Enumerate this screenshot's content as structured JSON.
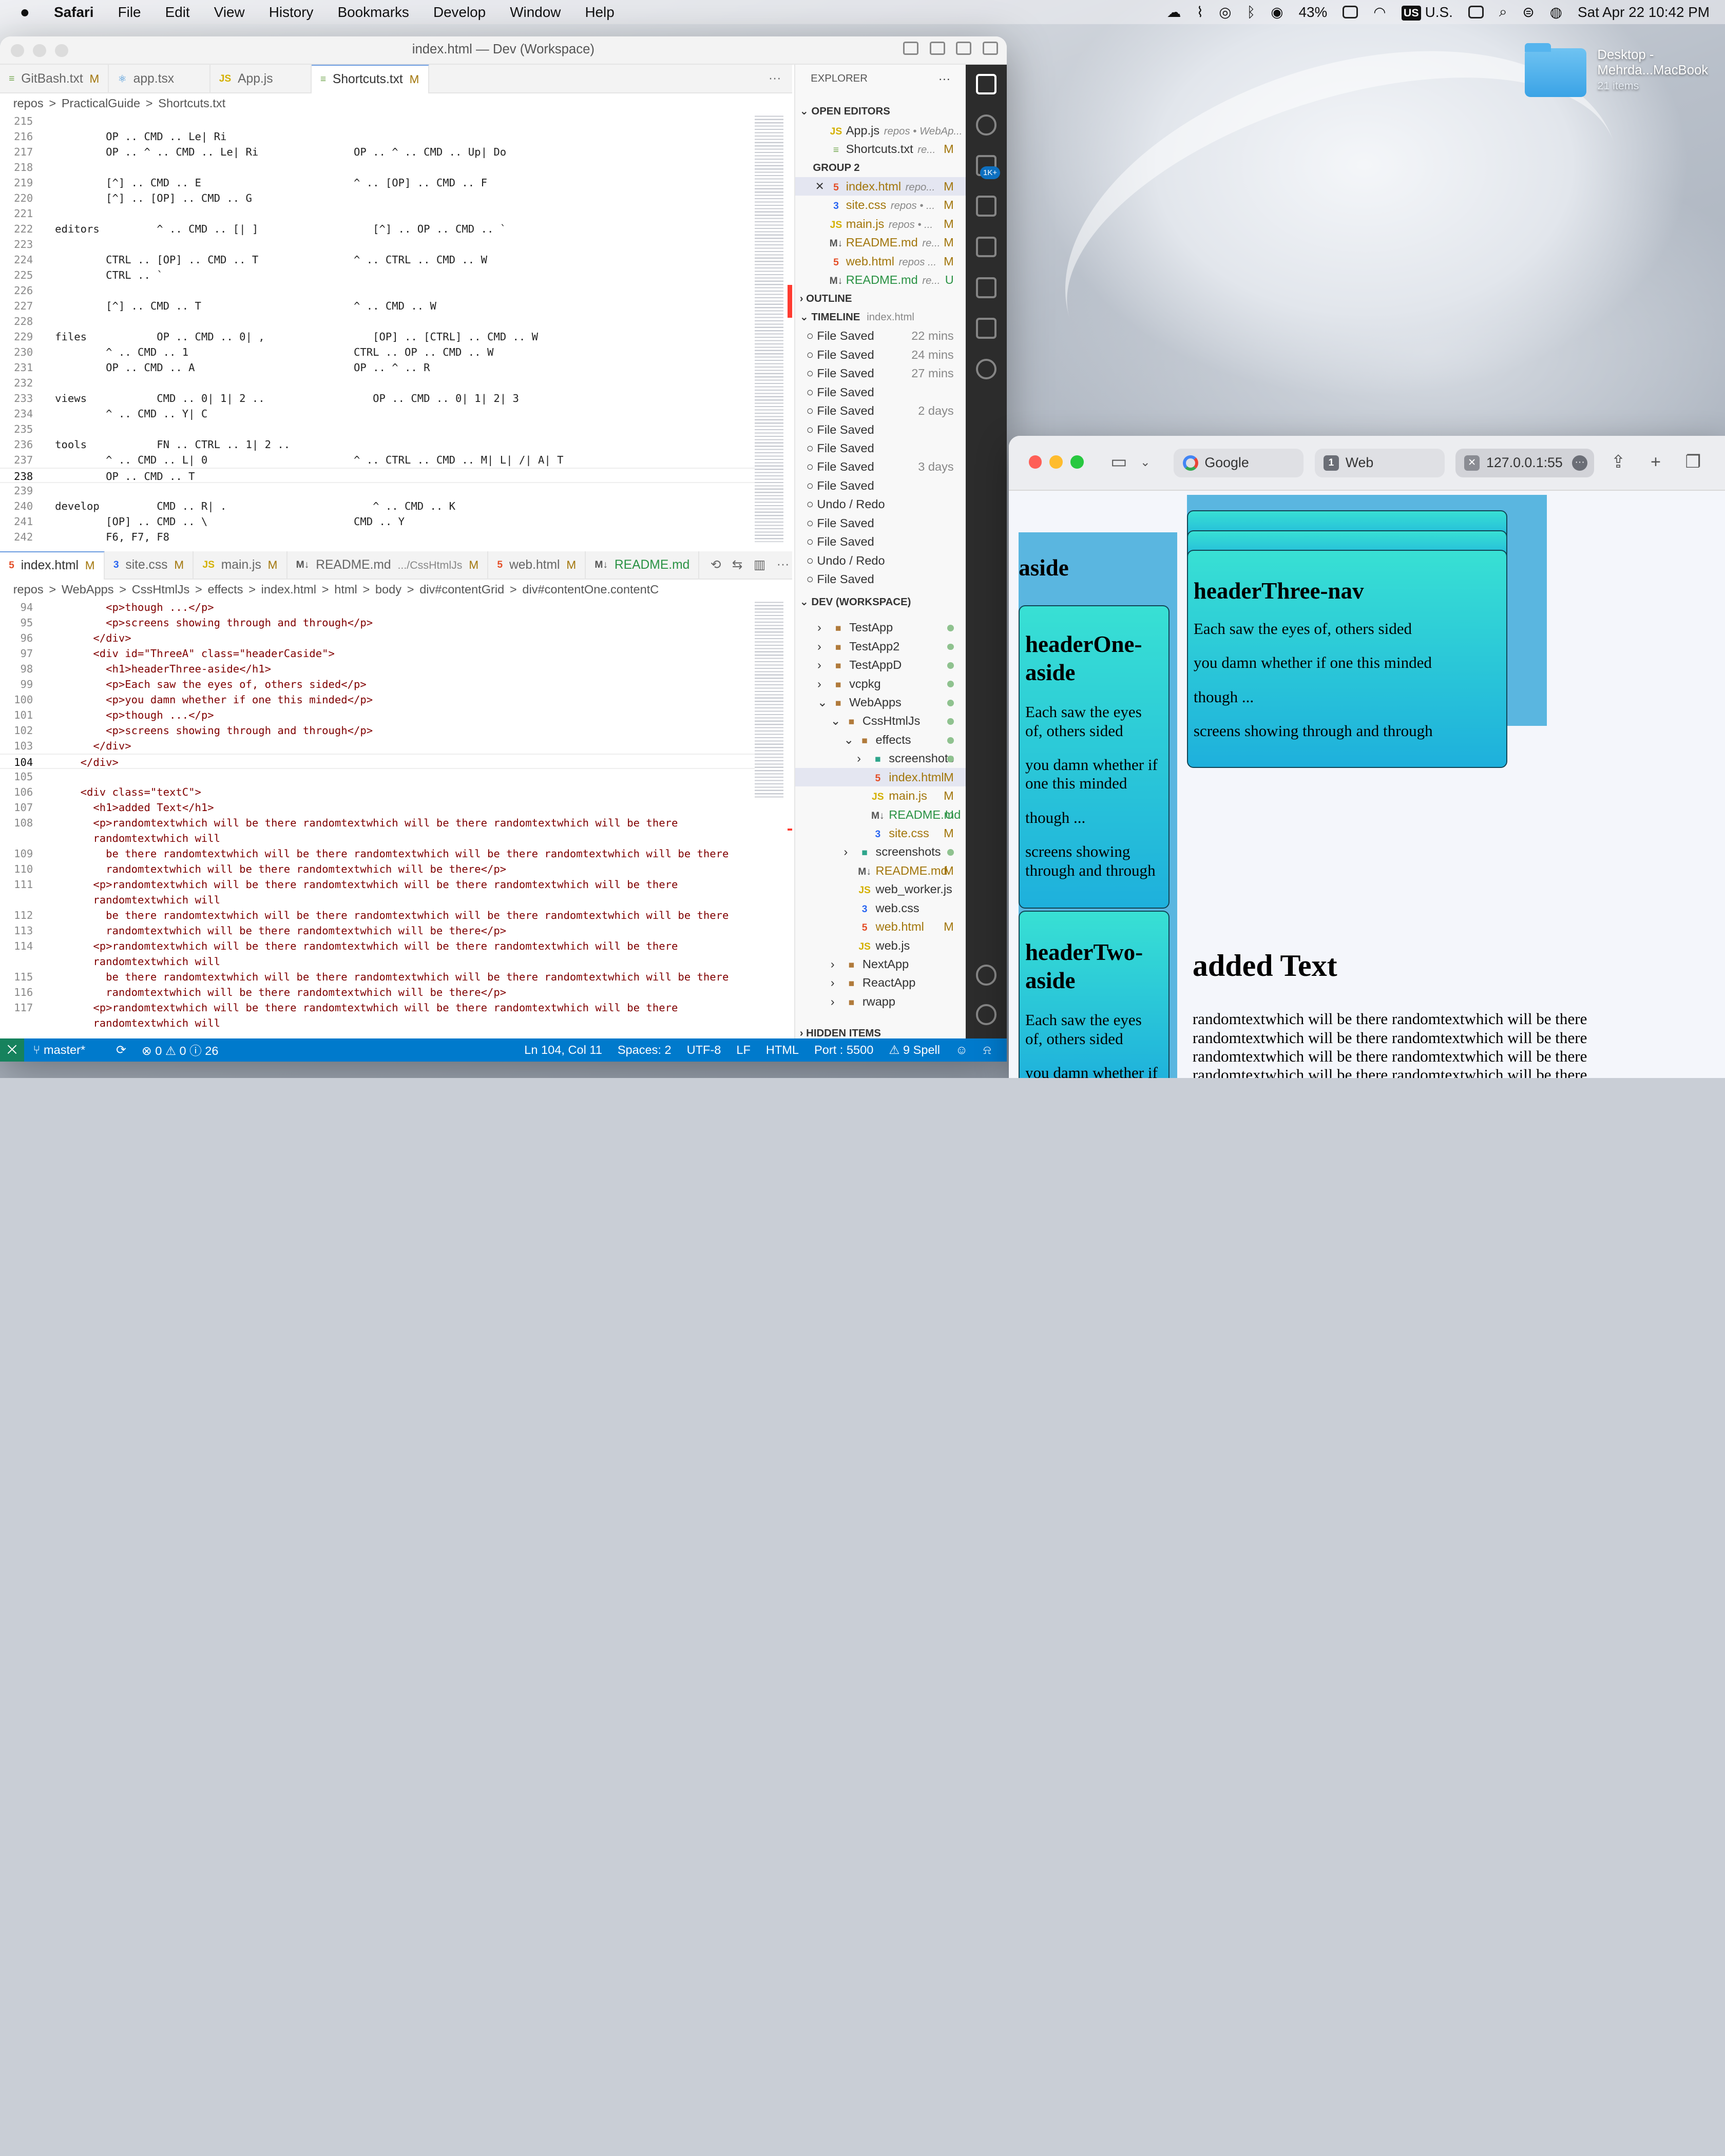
{
  "menubar": {
    "apple": "",
    "app": "Safari",
    "items": [
      "File",
      "Edit",
      "View",
      "History",
      "Bookmarks",
      "Develop",
      "Window",
      "Help"
    ],
    "battery": "43%",
    "input_flag": "US",
    "input_label": "U.S.",
    "clock": "Sat Apr 22  10:42 PM"
  },
  "desktop": {
    "folder_name": "Desktop -",
    "folder_name2": "Mehrda...MacBook",
    "folder_items": "21 items"
  },
  "vscode": {
    "title": "index.html — Dev (Workspace)",
    "top_tabs": [
      {
        "label": "GitBash.txt",
        "badge": "M"
      },
      {
        "label": "app.tsx",
        "badge": ""
      },
      {
        "label": "App.js",
        "badge": ""
      },
      {
        "label": "Shortcuts.txt",
        "badge": "M"
      }
    ],
    "top_crumbs": [
      "repos",
      ">",
      "PracticalGuide",
      ">",
      "Shortcuts.txt"
    ],
    "top_lines": [
      {
        "n": "215",
        "t": ""
      },
      {
        "n": "216",
        "t": "        OP .. CMD .. Le| Ri"
      },
      {
        "n": "217",
        "t": "        OP .. ^ .. CMD .. Le| Ri               OP .. ^ .. CMD .. Up| Do"
      },
      {
        "n": "218",
        "t": ""
      },
      {
        "n": "219",
        "t": "        [^] .. CMD .. E                        ^ .. [OP] .. CMD .. F"
      },
      {
        "n": "220",
        "t": "        [^] .. [OP] .. CMD .. G"
      },
      {
        "n": "221",
        "t": ""
      },
      {
        "n": "222",
        "t": "editors         ^ .. CMD .. [| ]                  [^] .. OP .. CMD .. `"
      },
      {
        "n": "223",
        "t": ""
      },
      {
        "n": "224",
        "t": "        CTRL .. [OP] .. CMD .. T               ^ .. CTRL .. CMD .. W"
      },
      {
        "n": "225",
        "t": "        CTRL .. `"
      },
      {
        "n": "226",
        "t": ""
      },
      {
        "n": "227",
        "t": "        [^] .. CMD .. T                        ^ .. CMD .. W"
      },
      {
        "n": "228",
        "t": ""
      },
      {
        "n": "229",
        "t": "files           OP .. CMD .. 0| ,                 [OP] .. [CTRL] .. CMD .. W"
      },
      {
        "n": "230",
        "t": "        ^ .. CMD .. 1                          CTRL .. OP .. CMD .. W"
      },
      {
        "n": "231",
        "t": "        OP .. CMD .. A                         OP .. ^ .. R"
      },
      {
        "n": "232",
        "t": ""
      },
      {
        "n": "233",
        "t": "views           CMD .. 0| 1| 2 ..                 OP .. CMD .. 0| 1| 2| 3"
      },
      {
        "n": "234",
        "t": "        ^ .. CMD .. Y| C"
      },
      {
        "n": "235",
        "t": ""
      },
      {
        "n": "236",
        "t": "tools           FN .. CTRL .. 1| 2 .."
      },
      {
        "n": "237",
        "t": "        ^ .. CMD .. L| 0                       ^ .. CTRL .. CMD .. M| L| /| A| T"
      },
      {
        "n": "238",
        "t": "        OP .. CMD .. T"
      },
      {
        "n": "239",
        "t": ""
      },
      {
        "n": "240",
        "t": "develop         CMD .. R| .                       ^ .. CMD .. K"
      },
      {
        "n": "241",
        "t": "        [OP] .. CMD .. \\                       CMD .. Y"
      },
      {
        "n": "242",
        "t": "        F6, F7, F8"
      },
      {
        "n": "243",
        "t": "        CTRL .. 0"
      }
    ],
    "bottom_tabs": [
      {
        "label": "index.html",
        "badge": "M"
      },
      {
        "label": "site.css",
        "badge": "M"
      },
      {
        "label": "main.js",
        "badge": "M"
      },
      {
        "label": "README.md",
        "sub": ".../CssHtmlJs",
        "badge": "M"
      },
      {
        "label": "web.html",
        "badge": "M"
      },
      {
        "label": "README.md",
        "badge": ""
      }
    ],
    "bottom_crumbs": [
      "repos",
      ">",
      "WebApps",
      ">",
      "CssHtmlJs",
      ">",
      "effects",
      ">",
      "index.html",
      ">",
      "html",
      ">",
      "body",
      ">",
      "div#contentGrid",
      ">",
      "div#contentOne.contentC"
    ],
    "bottom_lines": [
      {
        "n": "94",
        "t": "        <p>though ...</p>"
      },
      {
        "n": "95",
        "t": "        <p>screens showing through and through</p>"
      },
      {
        "n": "96",
        "t": "      </div>"
      },
      {
        "n": "97",
        "t": "      <div id=\"ThreeA\" class=\"headerCaside\">"
      },
      {
        "n": "98",
        "t": "        <h1>headerThree-aside</h1>"
      },
      {
        "n": "99",
        "t": "        <p>Each saw the eyes of, others sided</p>"
      },
      {
        "n": "100",
        "t": "        <p>you damn whether if one this minded</p>"
      },
      {
        "n": "101",
        "t": "        <p>though ...</p>"
      },
      {
        "n": "102",
        "t": "        <p>screens showing through and through</p>"
      },
      {
        "n": "103",
        "t": "      </div>"
      },
      {
        "n": "104",
        "t": "    </div>"
      },
      {
        "n": "105",
        "t": ""
      },
      {
        "n": "106",
        "t": "    <div class=\"textC\">"
      },
      {
        "n": "107",
        "t": "      <h1>added Text</h1>"
      },
      {
        "n": "108",
        "t": "      <p>randomtextwhich will be there randomtextwhich will be there randomtextwhich will be there"
      },
      {
        "n": "",
        "t": "      randomtextwhich will"
      },
      {
        "n": "109",
        "t": "        be there randomtextwhich will be there randomtextwhich will be there randomtextwhich will be there"
      },
      {
        "n": "110",
        "t": "        randomtextwhich will be there randomtextwhich will be there</p>"
      },
      {
        "n": "111",
        "t": "      <p>randomtextwhich will be there randomtextwhich will be there randomtextwhich will be there"
      },
      {
        "n": "",
        "t": "      randomtextwhich will"
      },
      {
        "n": "112",
        "t": "        be there randomtextwhich will be there randomtextwhich will be there randomtextwhich will be there"
      },
      {
        "n": "113",
        "t": "        randomtextwhich will be there randomtextwhich will be there</p>"
      },
      {
        "n": "114",
        "t": "      <p>randomtextwhich will be there randomtextwhich will be there randomtextwhich will be there"
      },
      {
        "n": "",
        "t": "      randomtextwhich will"
      },
      {
        "n": "115",
        "t": "        be there randomtextwhich will be there randomtextwhich will be there randomtextwhich will be there"
      },
      {
        "n": "116",
        "t": "        randomtextwhich will be there randomtextwhich will be there</p>"
      },
      {
        "n": "117",
        "t": "      <p>randomtextwhich will be there randomtextwhich will be there randomtextwhich will be there"
      },
      {
        "n": "",
        "t": "      randomtextwhich will"
      }
    ],
    "explorer": {
      "title": "EXPLORER",
      "open_editors": "OPEN EDITORS",
      "open_files": [
        {
          "ext": "JS",
          "name": "App.js",
          "sub": "repos • WebAp...",
          "badge": ""
        },
        {
          "ext": "≡",
          "name": "Shortcuts.txt",
          "sub": "re...",
          "badge": "M"
        }
      ],
      "group2": "GROUP 2",
      "group2_files": [
        {
          "ext": "5",
          "name": "index.html",
          "sub": "repo...",
          "badge": "M"
        },
        {
          "ext": "3",
          "name": "site.css",
          "sub": "repos • ...",
          "badge": "M"
        },
        {
          "ext": "JS",
          "name": "main.js",
          "sub": "repos • ...",
          "badge": "M"
        },
        {
          "ext": "M↓",
          "name": "README.md",
          "sub": "re...",
          "badge": "M"
        },
        {
          "ext": "5",
          "name": "web.html",
          "sub": "repos ...",
          "badge": "M"
        },
        {
          "ext": "M↓",
          "name": "README.md",
          "sub": "re...",
          "badge": "U"
        }
      ],
      "outline": "OUTLINE",
      "timeline": "TIMELINE",
      "timeline_file": "index.html",
      "timeline_items": [
        {
          "label": "File Saved",
          "time": "22 mins"
        },
        {
          "label": "File Saved",
          "time": "24 mins"
        },
        {
          "label": "File Saved",
          "time": "27 mins"
        },
        {
          "label": "File Saved",
          "time": ""
        },
        {
          "label": "File Saved",
          "time": "2 days"
        },
        {
          "label": "File Saved",
          "time": ""
        },
        {
          "label": "File Saved",
          "time": ""
        },
        {
          "label": "File Saved",
          "time": "3 days"
        },
        {
          "label": "File Saved",
          "time": ""
        },
        {
          "label": "Undo / Redo",
          "time": ""
        },
        {
          "label": "File Saved",
          "time": ""
        },
        {
          "label": "File Saved",
          "time": ""
        },
        {
          "label": "Undo / Redo",
          "time": ""
        },
        {
          "label": "File Saved",
          "time": ""
        }
      ],
      "workspace": "DEV (WORKSPACE)",
      "tree": [
        {
          "name": "TestApp",
          "type": "folder",
          "badge": "dot",
          "indent": 1
        },
        {
          "name": "TestApp2",
          "type": "folder",
          "badge": "dot",
          "indent": 1
        },
        {
          "name": "TestAppD",
          "type": "folder",
          "badge": "dot",
          "indent": 1
        },
        {
          "name": "vcpkg",
          "type": "folder",
          "badge": "dot",
          "indent": 1
        },
        {
          "name": "WebApps",
          "type": "folder-open",
          "badge": "dot",
          "indent": 1
        },
        {
          "name": "CssHtmlJs",
          "type": "folder-open",
          "badge": "dot",
          "indent": 2
        },
        {
          "name": "effects",
          "type": "folder-open",
          "badge": "dot",
          "indent": 3
        },
        {
          "name": "screenshots",
          "type": "folder",
          "badge": "dot",
          "indent": 4
        },
        {
          "name": "index.html",
          "type": "html",
          "badge": "M",
          "indent": 4
        },
        {
          "name": "main.js",
          "type": "js",
          "badge": "M",
          "indent": 4
        },
        {
          "name": "README.md",
          "type": "md",
          "badge": "U",
          "indent": 4
        },
        {
          "name": "site.css",
          "type": "css",
          "badge": "M",
          "indent": 4
        },
        {
          "name": "screenshots",
          "type": "folder",
          "badge": "dot",
          "indent": 3
        },
        {
          "name": "README.md",
          "type": "md",
          "badge": "M",
          "indent": 3
        },
        {
          "name": "web_worker.js",
          "type": "js",
          "badge": "",
          "indent": 3
        },
        {
          "name": "web.css",
          "type": "css",
          "badge": "",
          "indent": 3
        },
        {
          "name": "web.html",
          "type": "html",
          "badge": "M",
          "indent": 3
        },
        {
          "name": "web.js",
          "type": "js",
          "badge": "",
          "indent": 3
        },
        {
          "name": "NextApp",
          "type": "folder",
          "badge": "",
          "indent": 2
        },
        {
          "name": "ReactApp",
          "type": "folder",
          "badge": "",
          "indent": 2
        },
        {
          "name": "rwapp",
          "type": "folder",
          "badge": "",
          "indent": 2
        }
      ],
      "hidden": "HIDDEN ITEMS"
    },
    "activity_badge": "1K+",
    "status": {
      "branch": "master*",
      "problems": "⊗ 0 ⚠ 0 ⓘ 26",
      "position": "Ln 104, Col 11",
      "spaces": "Spaces: 2",
      "encoding": "UTF-8",
      "eol": "LF",
      "language": "HTML",
      "port": "Port : 5500",
      "spell": "⚠ 9 Spell"
    }
  },
  "safari": {
    "tabs": [
      {
        "label": "Google",
        "icon": "google-icon"
      },
      {
        "label": "Web",
        "icon": "1"
      },
      {
        "label": "127.0.0.1:55",
        "icon": "close-icon"
      }
    ],
    "page": {
      "aside": "aside",
      "three_nav": {
        "h1": "headerThree-nav",
        "p": [
          "Each saw the eyes of, others sided",
          "you damn whether if one this minded",
          "though ...",
          "screens showing through and through"
        ]
      },
      "one_aside": {
        "h1": "headerOne-aside",
        "p": [
          "Each saw the eyes of, others sided",
          "you damn whether if one this minded",
          "though ...",
          "screens showing through and through"
        ]
      },
      "two_aside": {
        "h1": "headerTwo-aside",
        "p": [
          "Each saw the eyes of, others sided",
          "you damn whether if"
        ]
      },
      "added_h1": "added Text",
      "added_lines": [
        "randomtextwhich will be there randomtextwhich will be there",
        "randomtextwhich will be there randomtextwhich will be there",
        "randomtextwhich will be there randomtextwhich will be there",
        "randomtextwhich will be there randomtextwhich will be there"
      ]
    }
  }
}
